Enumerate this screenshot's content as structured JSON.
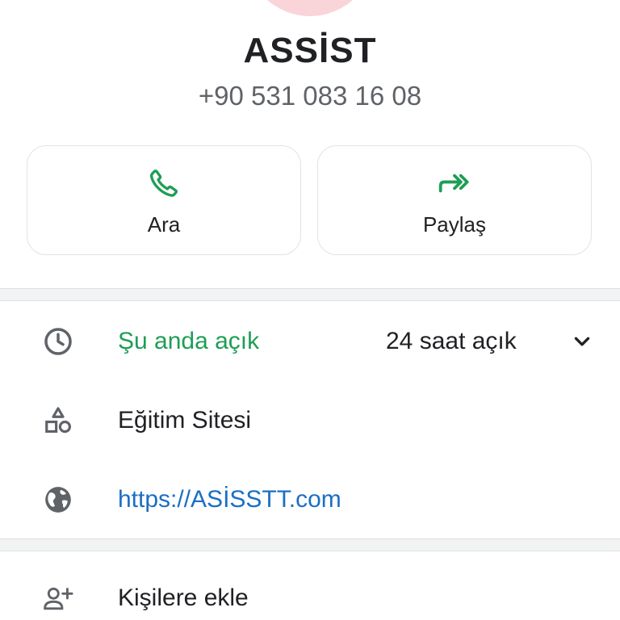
{
  "contact": {
    "name": "ASSİST",
    "phone": "+90 531 083 16 08"
  },
  "actions": {
    "call_label": "Ara",
    "share_label": "Paylaş"
  },
  "info": {
    "hours_status": "Şu anda açık",
    "hours_detail": "24 saat açık",
    "category": "Eğitim Sitesi",
    "website": "https://ASİSSTT.com"
  },
  "add_contact": {
    "label": "Kişilere ekle"
  },
  "colors": {
    "accent_green": "#1e9e55",
    "link_blue": "#1a6fc4",
    "avatar_pink": "#f9d4d8"
  },
  "icons": {
    "call": "phone-icon",
    "share": "share-forward-icon",
    "hours": "clock-icon",
    "category": "shapes-icon",
    "website": "globe-icon",
    "expand": "chevron-down-icon",
    "add_contact": "person-add-icon"
  }
}
